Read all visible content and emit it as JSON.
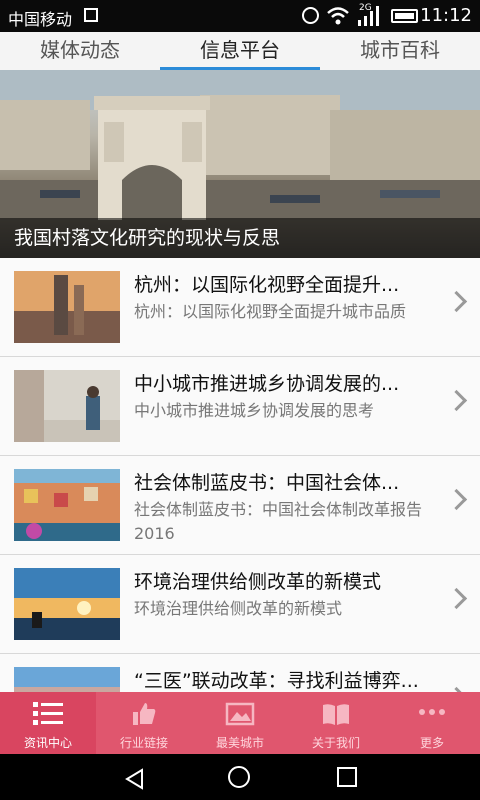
{
  "status": {
    "carrier": "中国移动",
    "network": "2G",
    "time": "11:12"
  },
  "tabs": [
    {
      "label": "媒体动态"
    },
    {
      "label": "信息平台"
    },
    {
      "label": "城市百科"
    }
  ],
  "banner": {
    "caption": "我国村落文化研究的现状与反思"
  },
  "articles": [
    {
      "title": "杭州：以国际化视野全面提升...",
      "desc": "杭州：以国际化视野全面提升城市品质"
    },
    {
      "title": "中小城市推进城乡协调发展的...",
      "desc": "中小城市推进城乡协调发展的思考"
    },
    {
      "title": "社会体制蓝皮书：中国社会体...",
      "desc": "社会体制蓝皮书：中国社会体制改革报告2016"
    },
    {
      "title": "环境治理供给侧改革的新模式",
      "desc": "环境治理供给侧改革的新模式"
    },
    {
      "title": "“三医”联动改革：寻找利益博弈...",
      "desc": ""
    }
  ],
  "bottom_nav": [
    {
      "label": "资讯中心",
      "icon": "list-icon"
    },
    {
      "label": "行业链接",
      "icon": "thumbs-up-icon"
    },
    {
      "label": "最美城市",
      "icon": "picture-icon"
    },
    {
      "label": "关于我们",
      "icon": "book-icon"
    },
    {
      "label": "更多",
      "icon": "more-icon"
    }
  ]
}
